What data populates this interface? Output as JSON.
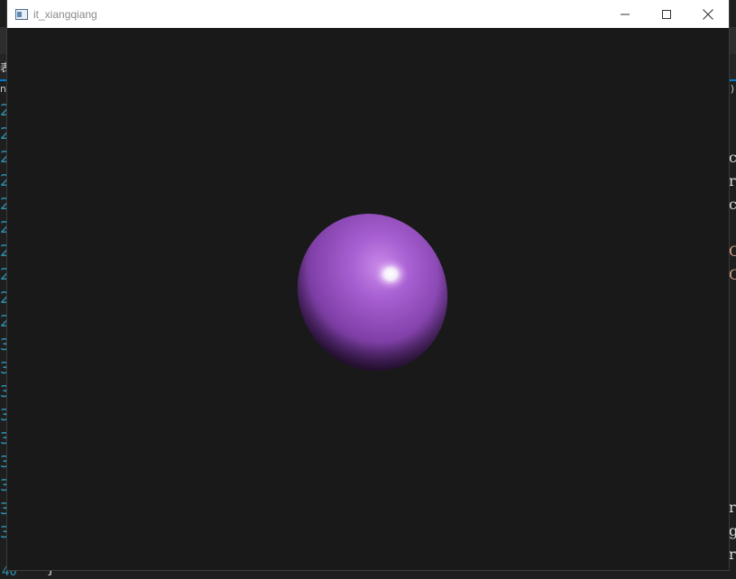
{
  "window": {
    "title": "it_xiangqiang",
    "controls": {
      "minimize_icon": "minimize-icon",
      "maximize_icon": "maximize-icon",
      "close_icon": "close-icon"
    }
  },
  "scene": {
    "object": "sphere",
    "base_color": "#9b4fc8",
    "highlight_color": "#ffffff",
    "shadow_color": "#2b1136",
    "background_color": "#191919"
  },
  "background_editor": {
    "tab_fragment": "表",
    "crumb_left": "n",
    "crumb_right": ")",
    "line_number_fragments": [
      "2",
      "2",
      "2",
      "2",
      "2",
      "2",
      "2",
      "2",
      "2",
      "2",
      "3",
      "3",
      "3",
      "3",
      "3",
      "3",
      "3",
      "3",
      "3"
    ],
    "right_code_fragments": [
      {
        "text": "c",
        "color": "#dcdcdc"
      },
      {
        "text": "r",
        "color": "#dcdcdc"
      },
      {
        "text": "c",
        "color": "#dcdcdc"
      },
      {
        "text": "C",
        "color": "#d69d85"
      },
      {
        "text": "C",
        "color": "#d69d85"
      },
      {
        "text": "r",
        "color": "#dcdcdc"
      },
      {
        "text": "g",
        "color": "#dcdcdc"
      },
      {
        "text": "r",
        "color": "#dcdcdc"
      }
    ],
    "bottom_line_number": "40",
    "bottom_brace": "}"
  }
}
